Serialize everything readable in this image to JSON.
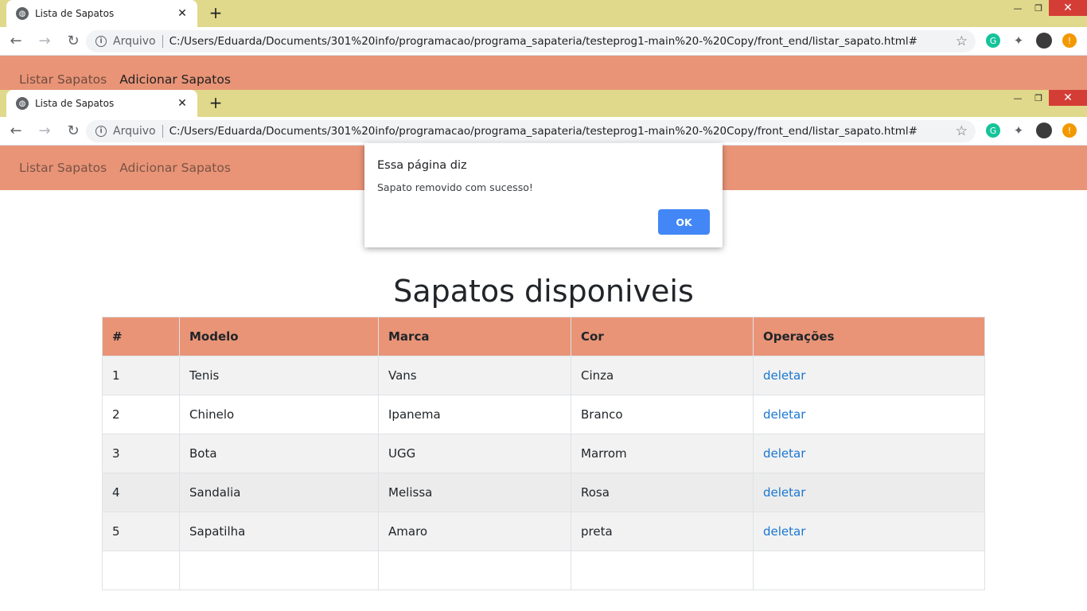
{
  "browser": {
    "tab_title": "Lista de Sapatos",
    "tab_close": "✕",
    "new_tab": "+",
    "minimize": "—",
    "restore": "❐",
    "close": "✕",
    "back": "←",
    "forward": "→",
    "reload": "↻",
    "info": "i",
    "scheme": "Arquivo",
    "url": "C:/Users/Eduarda/Documents/301%20info/programacao/programa_sapateria/testeprog1-main%20-%20Copy/front_end/listar_sapato.html#",
    "star": "☆",
    "ext_grammarly": "G",
    "ext_puzzle": "✦",
    "ext_update": "!"
  },
  "nav": {
    "items": [
      {
        "label": "Listar Sapatos"
      },
      {
        "label": "Adicionar Sapatos"
      }
    ]
  },
  "dialog": {
    "title": "Essa página diz",
    "message": "Sapato removido com sucesso!",
    "ok_label": "OK"
  },
  "main": {
    "title": "Sapatos disponiveis",
    "table": {
      "headers": [
        "#",
        "Modelo",
        "Marca",
        "Cor",
        "Operações"
      ],
      "rows": [
        {
          "id": "1",
          "modelo": "Tenis",
          "marca": "Vans",
          "cor": "Cinza",
          "op": "deletar"
        },
        {
          "id": "2",
          "modelo": "Chinelo",
          "marca": "Ipanema",
          "cor": "Branco",
          "op": "deletar"
        },
        {
          "id": "3",
          "modelo": "Bota",
          "marca": "UGG",
          "cor": "Marrom",
          "op": "deletar"
        },
        {
          "id": "4",
          "modelo": "Sandalia",
          "marca": "Melissa",
          "cor": "Rosa",
          "op": "deletar"
        },
        {
          "id": "5",
          "modelo": "Sapatilha",
          "marca": "Amaro",
          "cor": "preta",
          "op": "deletar"
        }
      ]
    }
  },
  "colors": {
    "tabstrip": "#e0d98b",
    "nav_bg": "#e99477",
    "link": "#1976d2",
    "ok_button": "#4287f5"
  }
}
